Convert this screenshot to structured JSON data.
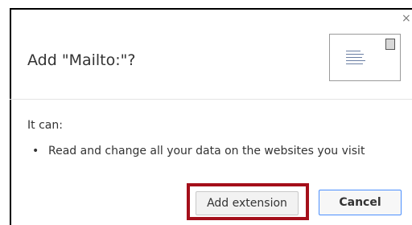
{
  "dialog": {
    "close_glyph": "×",
    "title": "Add \"Mailto:\"?",
    "icon": "envelope-icon",
    "permissions_heading": "It can:",
    "permissions": [
      "Read and change all your data on the websites you visit"
    ],
    "bullet": "•",
    "add_button": "Add extension",
    "cancel_button": "Cancel"
  },
  "colors": {
    "highlight": "#a40f1a",
    "cancel_border": "#4d90fe"
  }
}
